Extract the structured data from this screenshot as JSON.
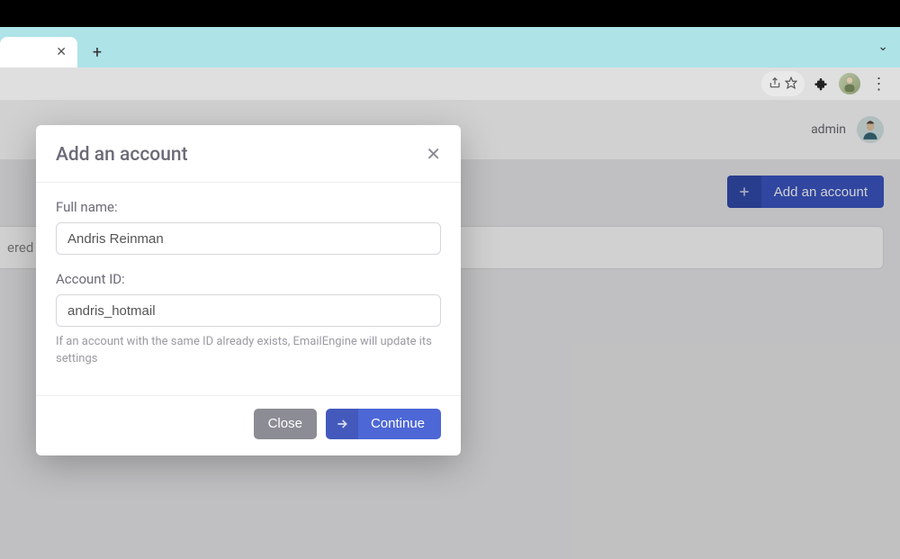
{
  "browser": {
    "chevron_icon": "⌄"
  },
  "toolbar_icons": {
    "share": "share-icon",
    "star": "star-icon",
    "puzzle": "extensions-icon",
    "avatar": "profile-avatar",
    "kebab": "⋮"
  },
  "app": {
    "user_label": "admin",
    "add_account_button": "Add an account",
    "bg_input_text": "ered y"
  },
  "modal": {
    "title": "Add an account",
    "fields": {
      "fullname": {
        "label": "Full name:",
        "value": "Andris Reinman"
      },
      "account_id": {
        "label": "Account ID:",
        "value": "andris_hotmail",
        "help": "If an account with the same ID already exists, EmailEngine will update its settings"
      }
    },
    "buttons": {
      "close": "Close",
      "continue": "Continue"
    }
  }
}
